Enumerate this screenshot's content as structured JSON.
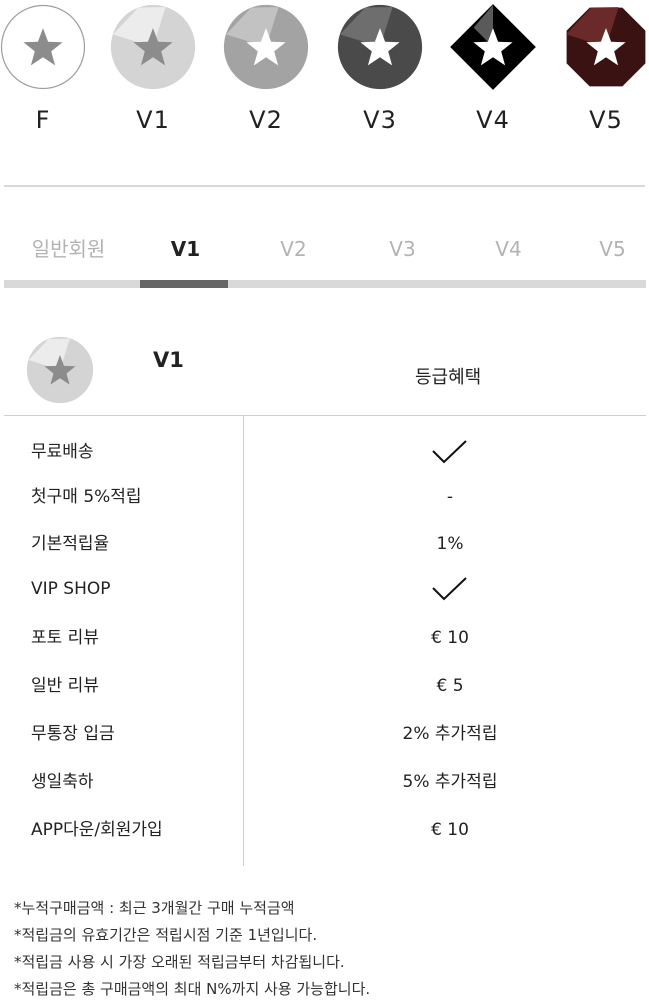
{
  "grade_badges": [
    {
      "label": "F",
      "shape": "circle",
      "fill": "#ffffff",
      "stroke": "#9e9e9e",
      "star": "#8c8c8c",
      "facet": ""
    },
    {
      "label": "V1",
      "shape": "circle",
      "fill": "#d4d4d4",
      "stroke": "#d4d4d4",
      "star": "#8c8c8c",
      "facet": "#ececec"
    },
    {
      "label": "V2",
      "shape": "circle",
      "fill": "#a3a3a3",
      "stroke": "#a3a3a3",
      "star": "#ffffff",
      "facet": "#c2c2c2"
    },
    {
      "label": "V3",
      "shape": "circle",
      "fill": "#4a4a4a",
      "stroke": "#4a4a4a",
      "star": "#ffffff",
      "facet": "#6e6e6e"
    },
    {
      "label": "V4",
      "shape": "diamond",
      "fill": "#000000",
      "stroke": "#000000",
      "star": "#ffffff",
      "facet": "#5a5a5a"
    },
    {
      "label": "V5",
      "shape": "octagon",
      "fill": "#3b1212",
      "stroke": "#3b1212",
      "star": "#ffffff",
      "facet": "#6b2a2a"
    }
  ],
  "tabs": [
    {
      "label": "일반회원",
      "active": false
    },
    {
      "label": "V1",
      "active": true
    },
    {
      "label": "V2",
      "active": false
    },
    {
      "label": "V3",
      "active": false
    },
    {
      "label": "V4",
      "active": false
    },
    {
      "label": "V5",
      "active": false
    }
  ],
  "card": {
    "level_name": "V1",
    "benefit_header": "등급혜택"
  },
  "benefits": [
    {
      "name": "무료배송",
      "value": "",
      "check": true
    },
    {
      "name": "첫구매 5%적립",
      "value": "-",
      "check": false
    },
    {
      "name": "기본적립율",
      "value": "1%",
      "check": false
    },
    {
      "name": "VIP SHOP",
      "value": "",
      "check": true
    },
    {
      "name": "포토 리뷰",
      "value": "€ 10",
      "check": false
    },
    {
      "name": "일반 리뷰",
      "value": "€ 5",
      "check": false
    },
    {
      "name": "무통장 입금",
      "value": "2% 추가적립",
      "check": false
    },
    {
      "name": "생일축하",
      "value": "5% 추가적립",
      "check": false
    },
    {
      "name": "APP다운/회원가입",
      "value": "€ 10",
      "check": false
    }
  ],
  "notes": [
    "*누적구매금액 : 최근 3개월간 구매 누적금액",
    "*적립금의 유효기간은 적립시점 기준 1년입니다.",
    "*적립금 사용 시 가장 오래된 적립금부터 차감됩니다.",
    "*적립금은 총 구매금액의 최대 N%까지 사용 가능합니다."
  ]
}
